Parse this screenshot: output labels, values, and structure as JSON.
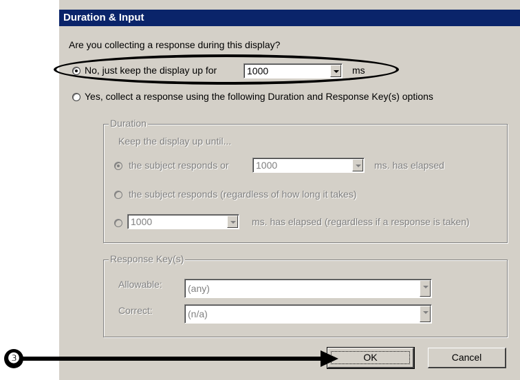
{
  "dialog": {
    "title": "Duration & Input",
    "question": "Are you collecting a response during this display?",
    "option_no": {
      "label": "No, just keep the display up for",
      "value": "1000",
      "unit": "ms",
      "selected": true
    },
    "option_yes": {
      "label": "Yes, collect a response using the following Duration and Response Key(s) options",
      "selected": false
    },
    "duration_group": {
      "legend": "Duration",
      "intro": "Keep the display up until...",
      "opt1_label": "the subject responds or",
      "opt1_value": "1000",
      "opt1_suffix": "ms. has elapsed",
      "opt2_label": "the subject responds (regardless of how long it takes)",
      "opt3_value": "1000",
      "opt3_suffix": "ms. has elapsed (regardless if a response is taken)"
    },
    "response_group": {
      "legend": "Response Key(s)",
      "allowable_label": "Allowable:",
      "allowable_value": "(any)",
      "correct_label": "Correct:",
      "correct_value": "(n/a)"
    },
    "ok_label": "OK",
    "cancel_label": "Cancel"
  },
  "annotation": {
    "step_number": "❸"
  },
  "colors": {
    "titlebar": "#0a246a",
    "dialog_bg": "#d4d0c8",
    "disabled_text": "#808080"
  }
}
